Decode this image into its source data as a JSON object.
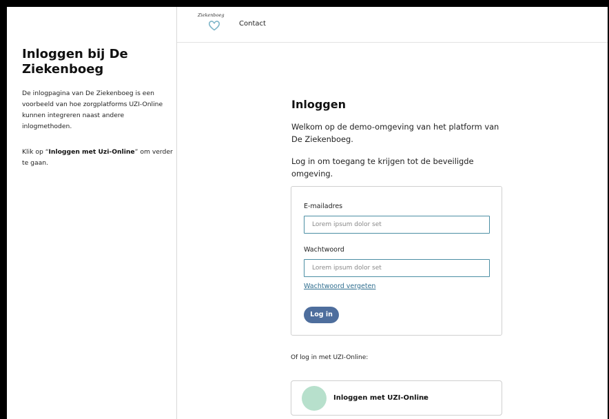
{
  "sidebar": {
    "title": "Inloggen bij De Ziekenboeg",
    "intro": "De inlogpagina van De Ziekenboeg is een voorbeeld van hoe zorgplatforms UZI-Online kunnen integreren naast andere inlogmethoden.",
    "hint_prefix": "Klik op “",
    "hint_bold": "Inloggen met Uzi-Online",
    "hint_suffix": "” om verder te gaan."
  },
  "header": {
    "logo_text": "Ziekenboeg",
    "logo_icon": "heart-icon",
    "nav_contact": "Contact"
  },
  "main": {
    "title": "Inloggen",
    "welcome": "Welkom op de demo-omgeving van het platform van De Ziekenboeg.",
    "instruction": "Log in om toegang te krijgen tot de beveiligde omgeving."
  },
  "form": {
    "email_label": "E-mailadres",
    "email_placeholder": "Lorem ipsum dolor set",
    "password_label": "Wachtwoord",
    "password_placeholder": "Lorem ipsum dolor set",
    "forgot_link": "Wachtwoord vergeten",
    "submit_label": "Log in"
  },
  "alt_login": {
    "prompt": "Of log in met UZI-Online:",
    "button_label": "Inloggen met UZI-Online",
    "chevron": "›"
  },
  "colors": {
    "primary_button": "#4e6e9d",
    "input_border": "#4a8da3",
    "link": "#2f6e8f",
    "uzi_circle": "#b7e0cc",
    "logo_heart": "#7fb6c9"
  }
}
